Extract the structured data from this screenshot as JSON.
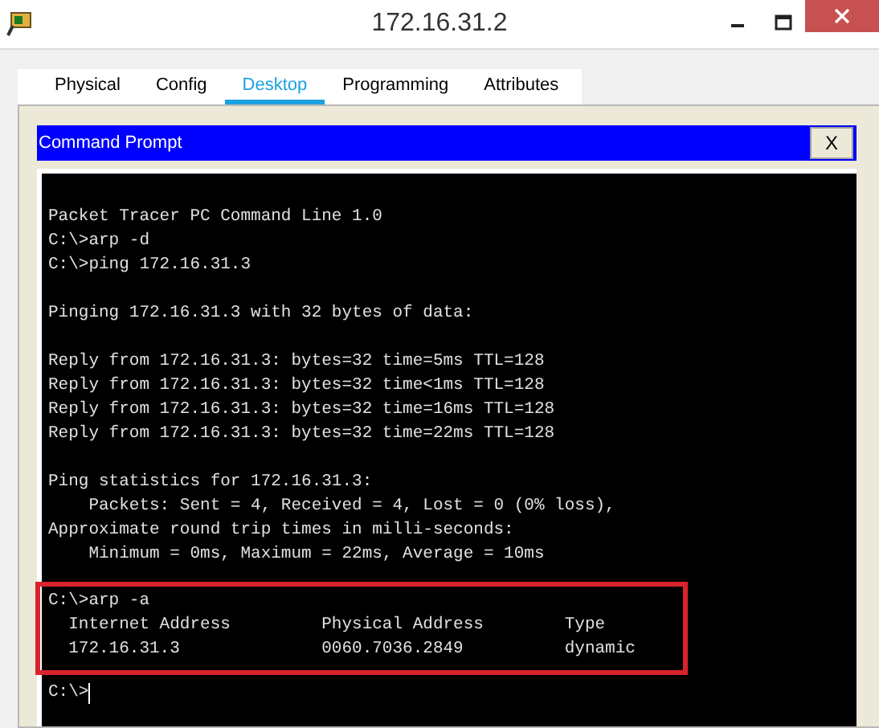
{
  "window": {
    "title": "172.16.31.2"
  },
  "tabs": [
    {
      "label": "Physical",
      "selected": false
    },
    {
      "label": "Config",
      "selected": false
    },
    {
      "label": "Desktop",
      "selected": true
    },
    {
      "label": "Programming",
      "selected": false
    },
    {
      "label": "Attributes",
      "selected": false
    }
  ],
  "command_prompt": {
    "title": "Command Prompt",
    "close_label": "X",
    "blocks": [
      {
        "highlighted": false,
        "lines": [
          "Packet Tracer PC Command Line 1.0",
          "C:\\>arp -d",
          "C:\\>ping 172.16.31.3"
        ]
      },
      {
        "highlighted": false,
        "lines": [
          "Pinging 172.16.31.3 with 32 bytes of data:"
        ]
      },
      {
        "highlighted": false,
        "lines": [
          "Reply from 172.16.31.3: bytes=32 time=5ms TTL=128",
          "Reply from 172.16.31.3: bytes=32 time<1ms TTL=128",
          "Reply from 172.16.31.3: bytes=32 time=16ms TTL=128",
          "Reply from 172.16.31.3: bytes=32 time=22ms TTL=128"
        ]
      },
      {
        "highlighted": false,
        "lines": [
          "Ping statistics for 172.16.31.3:",
          "    Packets: Sent = 4, Received = 4, Lost = 0 (0% loss),",
          "Approximate round trip times in milli-seconds:",
          "    Minimum = 0ms, Maximum = 22ms, Average = 10ms"
        ]
      },
      {
        "highlighted": true,
        "lines": [
          "C:\\>arp -a",
          "  Internet Address         Physical Address        Type",
          "  172.16.31.3              0060.7036.2849          dynamic"
        ]
      }
    ],
    "prompt": "C:\\>"
  }
}
